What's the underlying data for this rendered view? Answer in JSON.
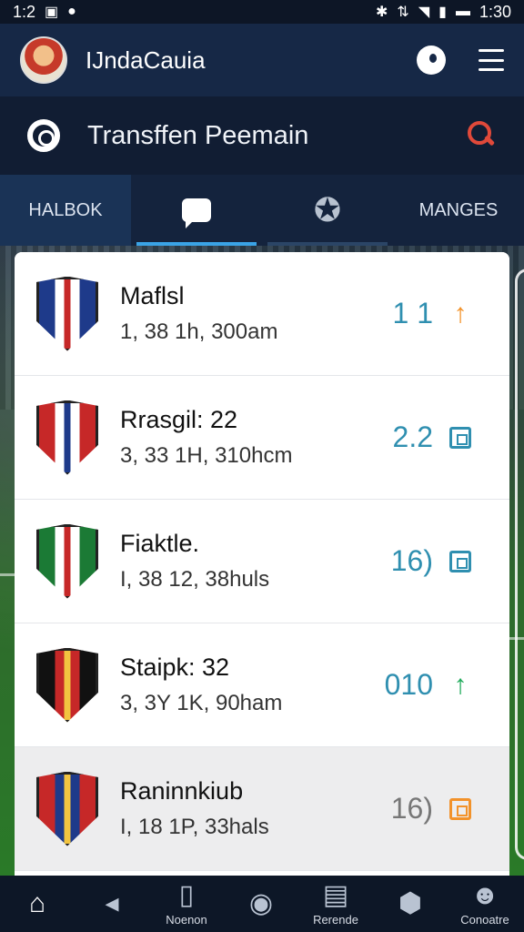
{
  "status_bar": {
    "time_left": "1:2",
    "time_right": "1:30",
    "icons_left": [
      "sim-icon",
      "dot-icon"
    ],
    "icons_right": [
      "bluetooth-icon",
      "data-icon",
      "wifi-icon",
      "signal-icon",
      "battery-icon"
    ]
  },
  "app_bar": {
    "title": "IJndaCauia",
    "avatar_icon": "avatar-mascot",
    "actions": [
      "profile-icon",
      "menu-icon"
    ]
  },
  "sub_header": {
    "title": "Transffen Peemain",
    "left_icon": "target-icon",
    "right_icon": "search-icon",
    "accent": "#e0493a"
  },
  "tabs": [
    {
      "label": "HALBOK",
      "selected": false
    },
    {
      "label": "",
      "icon": "chat-icon",
      "selected": true
    },
    {
      "label": "",
      "icon": "star-icon",
      "selected": false
    },
    {
      "label": "MANGES",
      "selected": false
    }
  ],
  "rows": [
    {
      "name": "Maflsl",
      "sub": "1, 38 1h, 300am",
      "score": "1 1",
      "score_color": "#2f8fb0",
      "status": "arrow-up",
      "status_color": "#f2922a",
      "crest_colors": [
        "#1e3a8a",
        "#ffffff",
        "#c62828"
      ]
    },
    {
      "name": "Rrasgil: 22",
      "sub": "3, 33 1H, 310hcm",
      "score": "2.2",
      "score_color": "#2f8fb0",
      "status": "box",
      "status_color": "#2f8fb0",
      "crest_colors": [
        "#c62828",
        "#ffffff",
        "#1e3a8a"
      ]
    },
    {
      "name": "Fiaktle.",
      "sub": "I, 38 12, 38huls",
      "score": "16)",
      "score_color": "#2f8fb0",
      "status": "box",
      "status_color": "#2f8fb0",
      "crest_colors": [
        "#1b7a35",
        "#ffffff",
        "#c62828"
      ]
    },
    {
      "name": "Staipk: 32",
      "sub": "3, 3Y 1K, 90ham",
      "score": "010",
      "score_color": "#2f8fb0",
      "status": "arrow-up",
      "status_color": "#1faa5a",
      "crest_colors": [
        "#111111",
        "#c62828",
        "#f2c440"
      ]
    },
    {
      "name": "Raninnkiub",
      "sub": "I, 18 1P, 33hals",
      "score": "16)",
      "score_color": "#777777",
      "status": "box",
      "status_color": "#f2922a",
      "crest_colors": [
        "#c62828",
        "#1e3a8a",
        "#f2c440"
      ]
    }
  ],
  "bottom_nav": [
    {
      "icon": "home-icon",
      "label": ""
    },
    {
      "icon": "back-icon",
      "label": ""
    },
    {
      "icon": "cards-icon",
      "label": "Noenon"
    },
    {
      "icon": "record-icon",
      "label": ""
    },
    {
      "icon": "calendar-icon",
      "label": "Rerende"
    },
    {
      "icon": "shield-icon",
      "label": ""
    },
    {
      "icon": "person-icon",
      "label": "Conoatre"
    }
  ]
}
